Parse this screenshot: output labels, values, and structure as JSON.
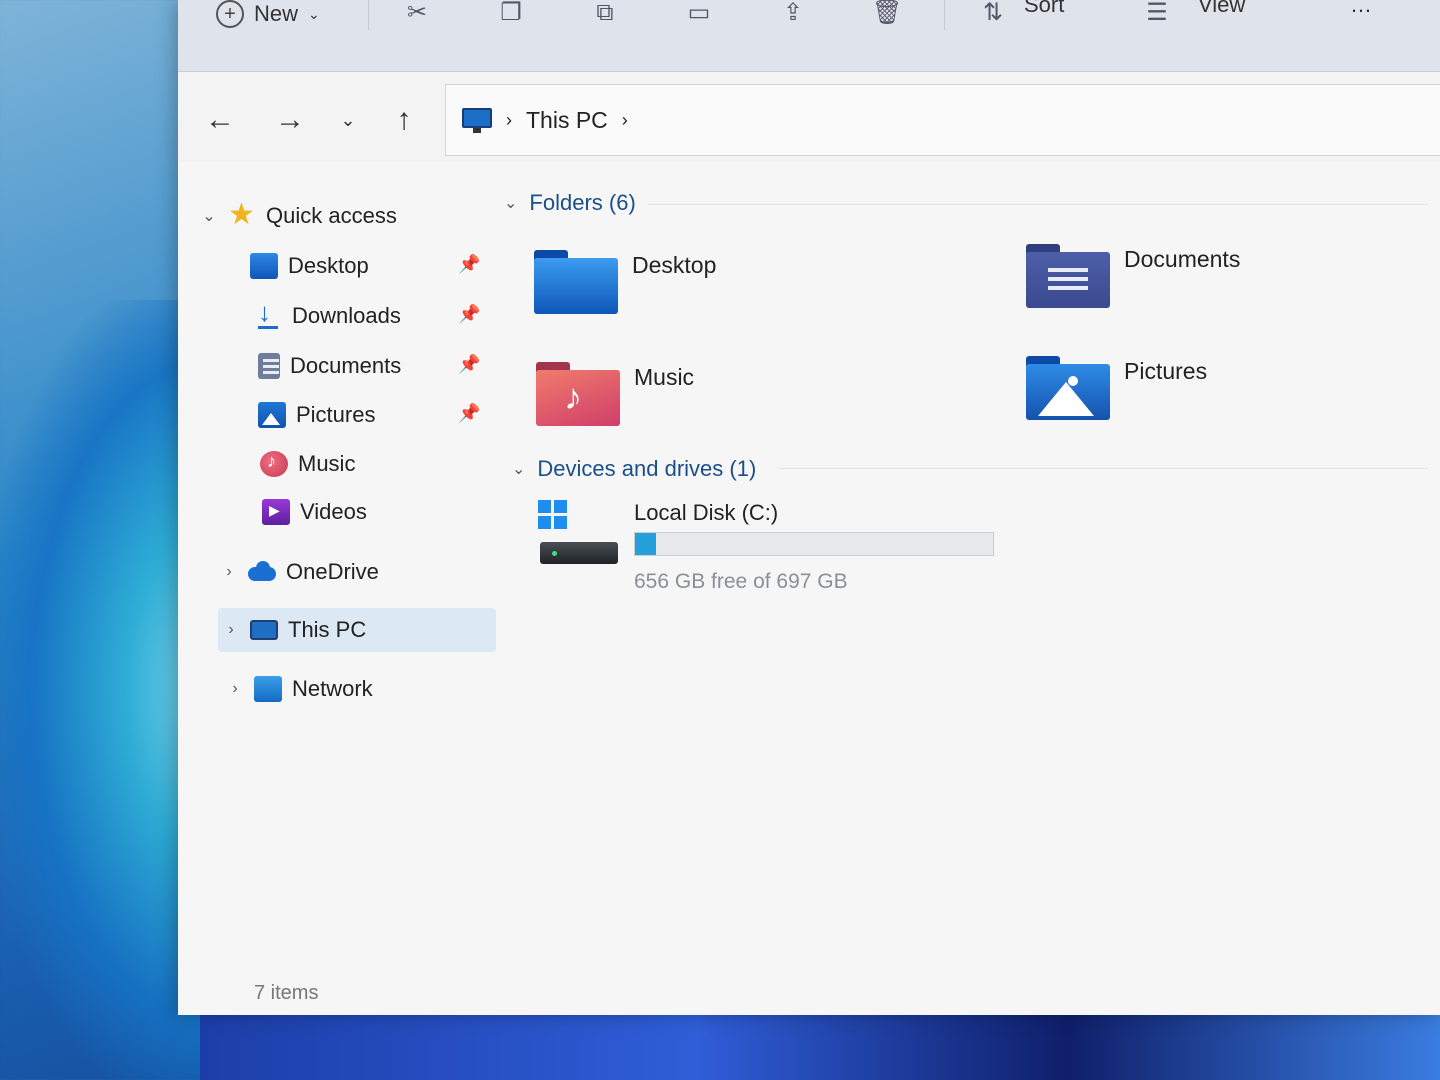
{
  "toolbar": {
    "new_label": "New",
    "sort_label": "Sort",
    "view_label": "View"
  },
  "address": {
    "segments": [
      "This PC"
    ]
  },
  "sidebar": {
    "quick_access": "Quick access",
    "items": [
      {
        "label": "Desktop",
        "icon": "desktop-icon",
        "pinned": true
      },
      {
        "label": "Downloads",
        "icon": "downloads-icon",
        "pinned": true
      },
      {
        "label": "Documents",
        "icon": "documents-icon",
        "pinned": true
      },
      {
        "label": "Pictures",
        "icon": "pictures-icon",
        "pinned": true
      },
      {
        "label": "Music",
        "icon": "music-icon",
        "pinned": false
      },
      {
        "label": "Videos",
        "icon": "videos-icon",
        "pinned": false
      }
    ],
    "onedrive": "OneDrive",
    "this_pc": "This PC",
    "network": "Network"
  },
  "content": {
    "folders_header": "Folders (6)",
    "folders": [
      {
        "label": "Desktop"
      },
      {
        "label": "Documents"
      },
      {
        "label": "Music"
      },
      {
        "label": "Pictures"
      }
    ],
    "devices_header": "Devices and drives (1)",
    "drive": {
      "name": "Local Disk (C:)",
      "free_text": "656 GB free of 697 GB",
      "used_fraction": 0.059
    }
  },
  "status": {
    "items": "7 items"
  },
  "colors": {
    "accent": "#1a4f8a",
    "selection": "#dce8f4",
    "capacity_fill": "#26a0da"
  }
}
